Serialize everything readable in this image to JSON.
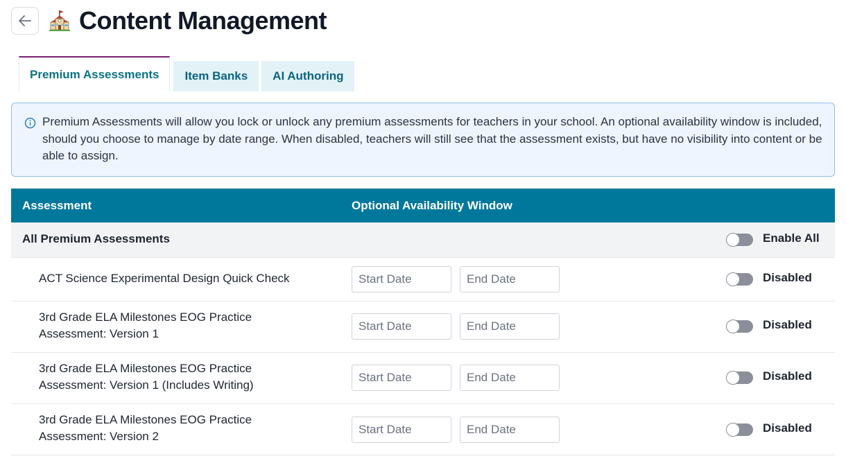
{
  "header": {
    "title": "Content Management",
    "back_icon": "arrow-left-icon",
    "title_icon": "school-building-icon"
  },
  "tabs": [
    {
      "label": "Premium Assessments",
      "active": true
    },
    {
      "label": "Item Banks",
      "active": false
    },
    {
      "label": "AI Authoring",
      "active": false
    }
  ],
  "info": {
    "icon": "info-circle-icon",
    "text": "Premium Assessments will allow you lock or unlock any premium assessments for teachers in your school. An optional availability window is included, should you choose to manage by date range. When disabled, teachers will still see that the assessment exists, but have no visibility into content or be able to assign."
  },
  "table": {
    "col_assessment": "Assessment",
    "col_window": "Optional Availability Window",
    "all_row": {
      "name": "All Premium Assessments",
      "toggle_label": "Enable All",
      "enabled": false
    },
    "start_placeholder": "Start Date",
    "end_placeholder": "End Date",
    "rows": [
      {
        "line1": "ACT Science Experimental Design Quick Check",
        "line2": "",
        "status": "Disabled",
        "enabled": false
      },
      {
        "line1": "3rd Grade ELA Milestones EOG Practice",
        "line2": "Assessment: Version 1",
        "status": "Disabled",
        "enabled": false
      },
      {
        "line1": "3rd Grade ELA Milestones EOG Practice",
        "line2": "Assessment: Version 1 (Includes Writing)",
        "status": "Disabled",
        "enabled": false
      },
      {
        "line1": "3rd Grade ELA Milestones EOG Practice",
        "line2": "Assessment: Version 2",
        "status": "Disabled",
        "enabled": false
      }
    ]
  },
  "colors": {
    "table_header": "#00789b",
    "tab_inactive_bg": "#e2f2f7",
    "tab_text": "#0b6480",
    "active_tab_border": "#7a1f72",
    "info_bg": "#eef5fe",
    "info_border": "#8fbde9",
    "toggle_off": "#8c8f9a"
  }
}
